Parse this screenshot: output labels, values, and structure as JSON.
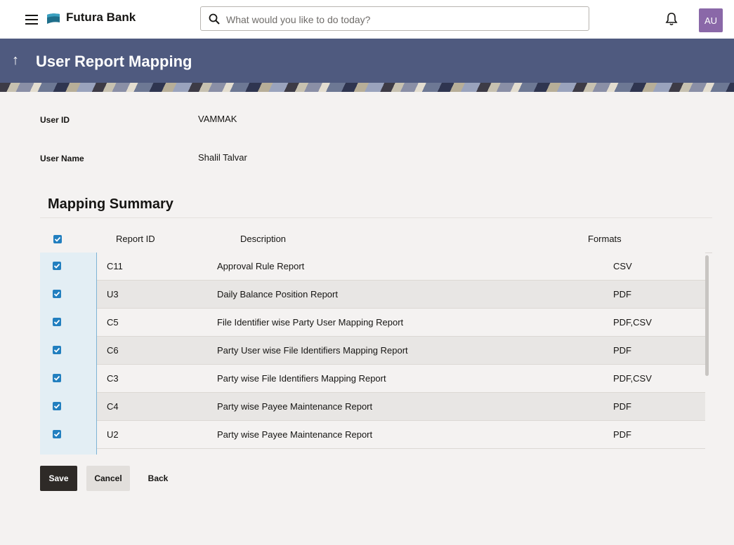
{
  "header": {
    "brand_name": "Futura Bank",
    "search_placeholder": "What would you like to do today?",
    "avatar_initials": "AU"
  },
  "banner": {
    "title": "User Report Mapping"
  },
  "details": {
    "user_id_label": "User ID",
    "user_id_value": "VAMMAK",
    "user_name_label": "User Name",
    "user_name_value": "Shalil Talvar"
  },
  "mapping": {
    "title": "Mapping Summary",
    "columns": {
      "report_id": "Report ID",
      "description": "Description",
      "formats": "Formats"
    },
    "select_all_checked": true,
    "rows": [
      {
        "report_id": "C11",
        "description": "Approval Rule Report",
        "formats": "CSV",
        "checked": true
      },
      {
        "report_id": "U3",
        "description": "Daily Balance Position Report",
        "formats": "PDF",
        "checked": true
      },
      {
        "report_id": "C5",
        "description": "File Identifier wise Party User Mapping Report",
        "formats": "PDF,CSV",
        "checked": true
      },
      {
        "report_id": "C6",
        "description": "Party User wise File Identifiers Mapping Report",
        "formats": "PDF",
        "checked": true
      },
      {
        "report_id": "C3",
        "description": "Party wise File Identifiers Mapping Report",
        "formats": "PDF,CSV",
        "checked": true
      },
      {
        "report_id": "C4",
        "description": "Party wise Payee Maintenance Report",
        "formats": "PDF",
        "checked": true
      },
      {
        "report_id": "U2",
        "description": "Party wise Payee Maintenance Report",
        "formats": "PDF",
        "checked": true
      }
    ]
  },
  "actions": {
    "save_label": "Save",
    "cancel_label": "Cancel",
    "back_label": "Back"
  },
  "colors": {
    "banner": "#4f5a7f",
    "checkbox": "#227fbf",
    "primary_button": "#2e2a27",
    "avatar": "#8a68a8"
  },
  "icons": [
    "menu-icon",
    "bank-logo-icon",
    "search-icon",
    "bell-icon",
    "back-arrow-icon",
    "checkbox-checked-icon"
  ]
}
